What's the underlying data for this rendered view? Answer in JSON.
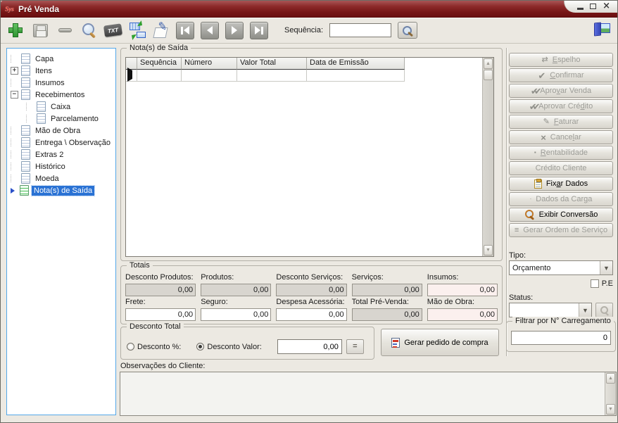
{
  "window": {
    "title": "Pré Venda",
    "minimize": "_",
    "close": "×"
  },
  "toolbar": {
    "txt_label": "TXT",
    "sequencia_label": "Sequência:",
    "sequencia_value": ""
  },
  "tree": {
    "items": [
      {
        "label": "Capa",
        "expander": ""
      },
      {
        "label": "Itens",
        "expander": "+"
      },
      {
        "label": "Insumos",
        "expander": ""
      },
      {
        "label": "Recebimentos",
        "expander": "−"
      },
      {
        "label": "Caixa",
        "expander": ""
      },
      {
        "label": "Parcelamento",
        "expander": ""
      },
      {
        "label": "Mão de Obra",
        "expander": ""
      },
      {
        "label": "Entrega \\ Observação",
        "expander": ""
      },
      {
        "label": "Extras 2",
        "expander": ""
      },
      {
        "label": "Histórico",
        "expander": ""
      },
      {
        "label": "Moeda",
        "expander": ""
      },
      {
        "label": "Nota(s) de Saída",
        "expander": "",
        "selected": true
      }
    ]
  },
  "notas": {
    "title": "Nota(s) de Saída",
    "columns": [
      "Sequência",
      "Número",
      "Valor Total",
      "Data de Emissão"
    ]
  },
  "totais": {
    "title": "Totais",
    "fields": [
      {
        "label": "Desconto Produtos:",
        "value": "0,00"
      },
      {
        "label": "Produtos:",
        "value": "0,00"
      },
      {
        "label": "Desconto Serviços:",
        "value": "0,00"
      },
      {
        "label": "Serviços:",
        "value": "0,00"
      },
      {
        "label": "Insumos:",
        "value": "0,00"
      },
      {
        "label": "Frete:",
        "value": "0,00"
      },
      {
        "label": "Seguro:",
        "value": "0,00"
      },
      {
        "label": "Despesa Acessória:",
        "value": "0,00"
      },
      {
        "label": "Total Pré-Venda:",
        "value": "0,00"
      },
      {
        "label": "Mão de Obra:",
        "value": "0,00"
      }
    ]
  },
  "desconto": {
    "title": "Desconto Total",
    "percent_label": "Desconto %:",
    "valor_label": "Desconto Valor:",
    "valor_value": "0,00",
    "equals_label": "=",
    "gerar_pedido_label": "Gerar pedido de compra"
  },
  "observacoes": {
    "label": "Observações do Cliente:",
    "value": ""
  },
  "sidebar": {
    "buttons": [
      {
        "label": "Espelho",
        "accel": 0,
        "enabled": false
      },
      {
        "label": "Confirmar",
        "accel": 0,
        "enabled": false
      },
      {
        "label": "Aprovar Venda",
        "accel": 4,
        "enabled": false
      },
      {
        "label": "Aprovar Crédito",
        "accel": 11,
        "enabled": false
      },
      {
        "label": "Faturar",
        "accel": 0,
        "enabled": false
      },
      {
        "label": "Cancelar",
        "accel": 5,
        "enabled": false
      },
      {
        "label": "Rentabilidade",
        "accel": 0,
        "enabled": false
      },
      {
        "label": "Crédito Cliente",
        "accel": -1,
        "enabled": false
      },
      {
        "label": "Fixar Dados",
        "accel": 3,
        "enabled": true
      },
      {
        "label": "Dados da Carga",
        "accel": 12,
        "enabled": false
      },
      {
        "label": "Exibir Conversão",
        "accel": -1,
        "enabled": true
      },
      {
        "label": "Gerar Ordem de Serviço",
        "accel": -1,
        "enabled": false
      }
    ],
    "tipo_label": "Tipo:",
    "tipo_value": "Orçamento",
    "pe_label": "P.E",
    "status_label": "Status:",
    "status_value": "",
    "filtrar_title": "Filtrar por N° Carregamento",
    "filtrar_value": "0"
  },
  "colors": {
    "titlebar": "#7b1d1d",
    "tree_border": "#53a7e8",
    "selection": "#2a72d4",
    "pink_field": "#fbf0ee",
    "gray_field": "#d8d5cf"
  }
}
